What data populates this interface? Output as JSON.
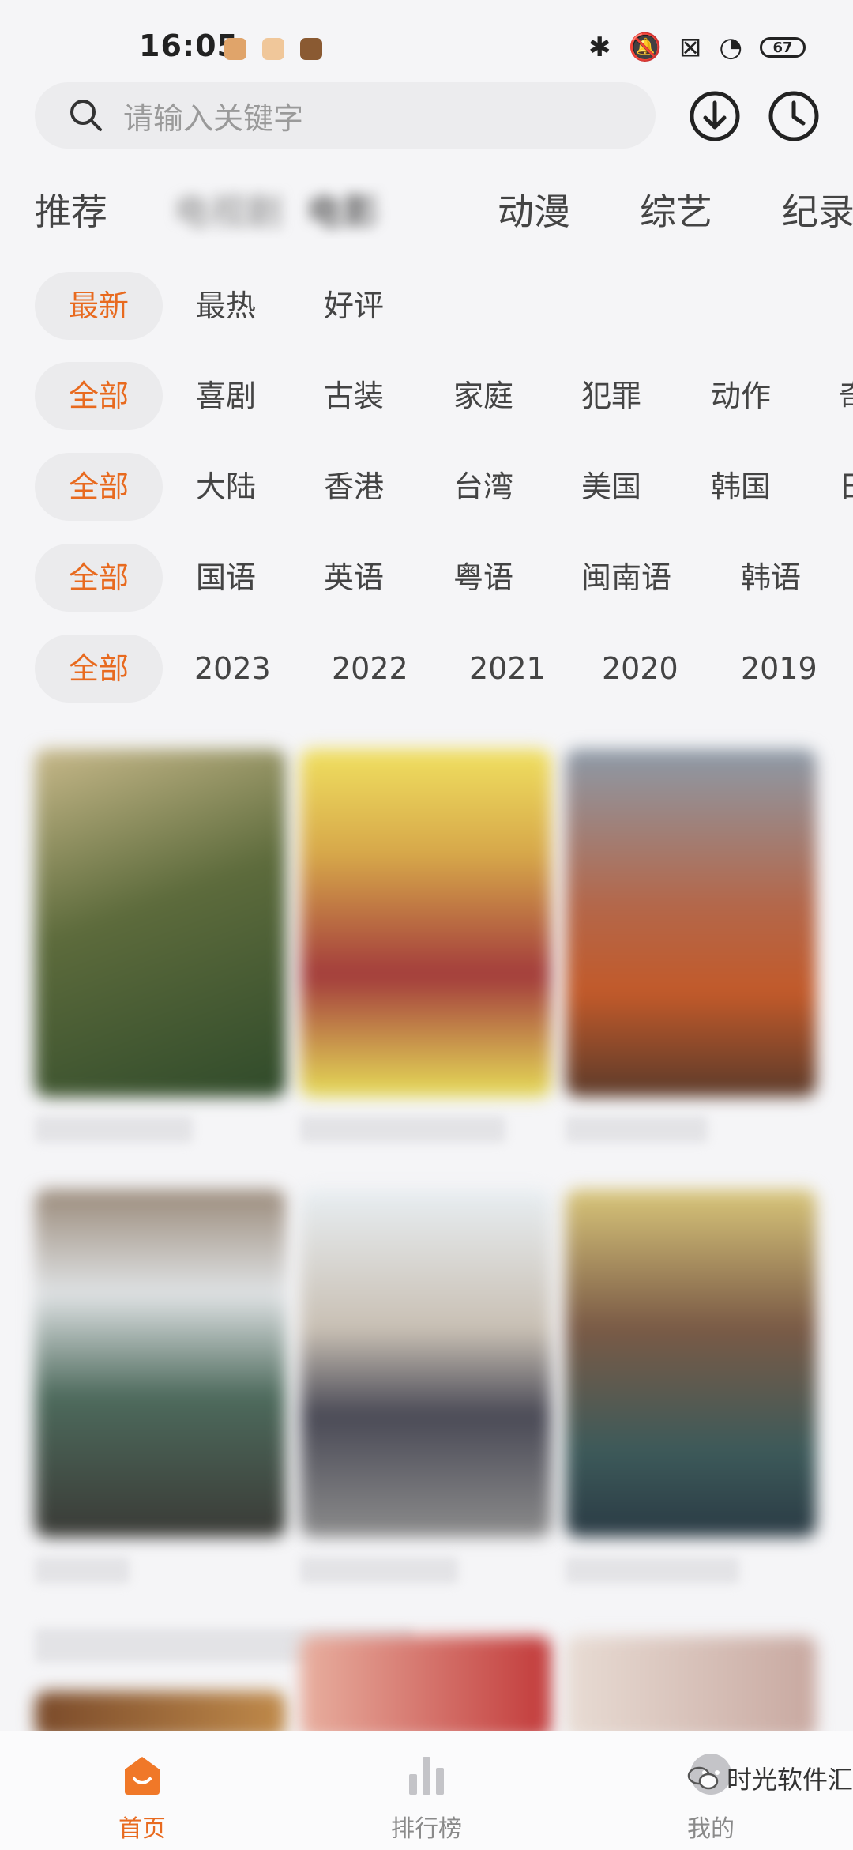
{
  "status_bar": {
    "time": "16:05",
    "battery": "67"
  },
  "search": {
    "placeholder": "请输入关键字"
  },
  "category_tabs": [
    "推荐",
    "电视剧",
    "电影",
    "动漫",
    "综艺",
    "纪录"
  ],
  "filters": {
    "sort": [
      "最新",
      "最热",
      "好评"
    ],
    "genre": [
      "全部",
      "喜剧",
      "古装",
      "家庭",
      "犯罪",
      "动作",
      "奇"
    ],
    "region": [
      "全部",
      "大陆",
      "香港",
      "台湾",
      "美国",
      "韩国",
      "日"
    ],
    "language": [
      "全部",
      "国语",
      "英语",
      "粤语",
      "闽南语",
      "韩语"
    ],
    "year": [
      "全部",
      "2023",
      "2022",
      "2021",
      "2020",
      "2019"
    ]
  },
  "bottom_nav": {
    "home": "首页",
    "ranking": "排行榜",
    "mine": "我的"
  },
  "watermark": "时光软件汇",
  "colors": {
    "accent": "#e86a1f",
    "chip_bg": "#ebebed",
    "background": "#f5f5f7"
  }
}
